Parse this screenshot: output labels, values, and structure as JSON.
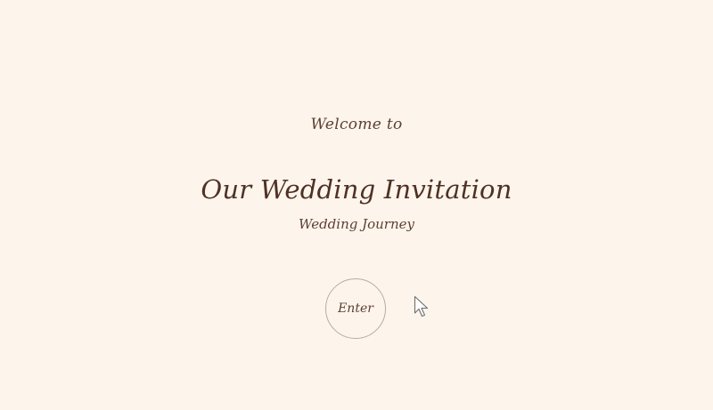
{
  "landing": {
    "welcome": "Welcome to",
    "title": "Our Wedding Invitation",
    "subtitle": "Wedding Journey",
    "enter_label": "Enter"
  },
  "colors": {
    "background": "#fdf5ec",
    "text": "#5a3b2e",
    "button_border": "#b9aaa1"
  },
  "icons": {
    "cursor": "arrow-cursor-icon"
  }
}
